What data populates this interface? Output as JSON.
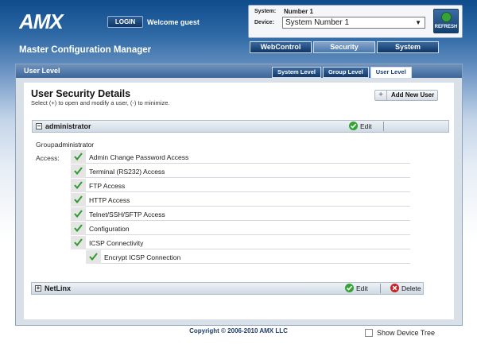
{
  "header": {
    "logo_text": "AMX",
    "login_label": "LOGIN",
    "welcome": "Welcome guest",
    "system_label": "System:",
    "system_value": "Number 1",
    "device_label": "Device:",
    "device_selected": "System Number 1",
    "refresh_label": "REFRESH"
  },
  "app_title": "Master Configuration Manager",
  "main_tabs": [
    {
      "label": "WebControl",
      "active": false
    },
    {
      "label": "Security",
      "active": true
    },
    {
      "label": "System",
      "active": false
    }
  ],
  "panel": {
    "title": "User Level",
    "sub_tabs": [
      {
        "label": "System Level",
        "active": false
      },
      {
        "label": "Group Level",
        "active": false
      },
      {
        "label": "User Level",
        "active": true
      }
    ]
  },
  "details": {
    "title": "User Security Details",
    "subtitle": "Select (+) to open and modify a user, (-) to minimize.",
    "add_user_label": "Add New User"
  },
  "users": [
    {
      "name": "administrator",
      "expanded": true,
      "edit_label": "Edit",
      "group_label": "Group:",
      "group_value": "administrator",
      "access_label": "Access:",
      "access": [
        {
          "label": "Admin Change Password Access",
          "checked": true
        },
        {
          "label": "Terminal (RS232) Access",
          "checked": true
        },
        {
          "label": "FTP Access",
          "checked": true
        },
        {
          "label": "HTTP Access",
          "checked": true
        },
        {
          "label": "Telnet/SSH/SFTP Access",
          "checked": true
        },
        {
          "label": "Configuration",
          "checked": true
        },
        {
          "label": "ICSP Connectivity",
          "checked": true
        },
        {
          "label": "Encrypt ICSP Connection",
          "checked": true
        }
      ]
    },
    {
      "name": "NetLinx",
      "expanded": false,
      "edit_label": "Edit",
      "delete_label": "Delete"
    }
  ],
  "footer": {
    "copyright": "Copyright © 2006-2010 AMX LLC",
    "show_device_tree": "Show Device Tree"
  },
  "colors": {
    "accent_green": "#33a333",
    "delete_red": "#cc2222",
    "tab_blue": "#123a69"
  }
}
